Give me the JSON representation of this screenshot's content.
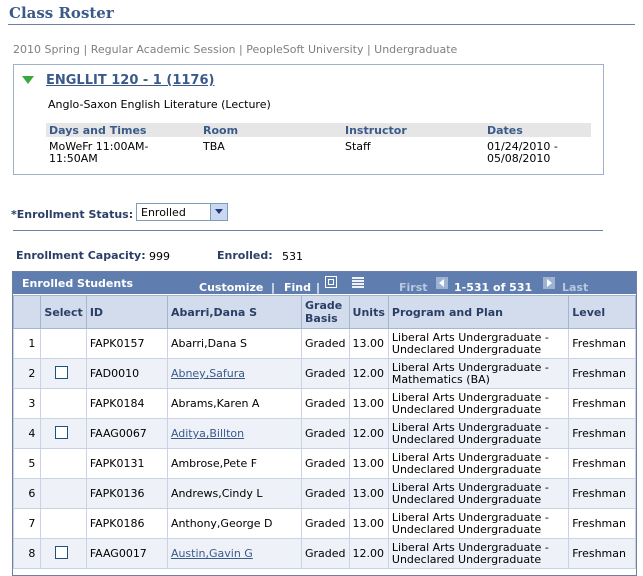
{
  "page": {
    "title": "Class Roster",
    "breadcrumb": "2010 Spring | Regular Academic Session | PeopleSoft University | Undergraduate"
  },
  "class_info": {
    "link": "ENGLLIT 120 - 1 (1176)",
    "description": "Anglo-Saxon English Literature (Lecture)",
    "headers": [
      "Days and Times",
      "Room",
      "Instructor",
      "Dates"
    ],
    "days_times": "MoWeFr 11:00AM-\n11:50AM",
    "room": "TBA",
    "instructor": "Staff",
    "dates": "01/24/2010 -\n05/08/2010"
  },
  "enrollment": {
    "status_label": "*Enrollment Status:",
    "status_value": "Enrolled",
    "capacity_label": "Enrollment Capacity:",
    "capacity_value": "999",
    "enrolled_label": "Enrolled:",
    "enrolled_value": "531"
  },
  "grid": {
    "title": "Enrolled Students",
    "customize": "Customize",
    "find": "Find",
    "sep": "|",
    "first": "First",
    "range": "1-531 of 531",
    "last": "Last",
    "columns": [
      "",
      "Select",
      "ID",
      "Abarri,Dana S",
      "Grade Basis",
      "Units",
      "Program and Plan",
      "Level"
    ],
    "rows": [
      {
        "n": "1",
        "select": false,
        "id": "FAPK0157",
        "name": "Abarri,Dana S",
        "link": false,
        "grade": "Graded",
        "units": "13.00",
        "plan": "Liberal Arts Undergraduate - Undeclared Undergraduate",
        "level": "Freshman"
      },
      {
        "n": "2",
        "select": true,
        "id": "FAD0010",
        "name": "Abney,Safura",
        "link": true,
        "grade": "Graded",
        "units": "12.00",
        "plan": "Liberal Arts Undergraduate - Mathematics (BA)",
        "level": "Freshman"
      },
      {
        "n": "3",
        "select": false,
        "id": "FAPK0184",
        "name": "Abrams,Karen A",
        "link": false,
        "grade": "Graded",
        "units": "13.00",
        "plan": "Liberal Arts Undergraduate - Undeclared Undergraduate",
        "level": "Freshman"
      },
      {
        "n": "4",
        "select": true,
        "id": "FAAG0067",
        "name": "Aditya,Billton",
        "link": true,
        "grade": "Graded",
        "units": "12.00",
        "plan": "Liberal Arts Undergraduate - Undeclared Undergraduate",
        "level": "Freshman"
      },
      {
        "n": "5",
        "select": false,
        "id": "FAPK0131",
        "name": "Ambrose,Pete F",
        "link": false,
        "grade": "Graded",
        "units": "13.00",
        "plan": "Liberal Arts Undergraduate - Undeclared Undergraduate",
        "level": "Freshman"
      },
      {
        "n": "6",
        "select": false,
        "id": "FAPK0136",
        "name": "Andrews,Cindy L",
        "link": false,
        "grade": "Graded",
        "units": "13.00",
        "plan": "Liberal Arts Undergraduate - Undeclared Undergraduate",
        "level": "Freshman"
      },
      {
        "n": "7",
        "select": false,
        "id": "FAPK0186",
        "name": "Anthony,George D",
        "link": false,
        "grade": "Graded",
        "units": "13.00",
        "plan": "Liberal Arts Undergraduate - Undeclared Undergraduate",
        "level": "Freshman"
      },
      {
        "n": "8",
        "select": true,
        "id": "FAAG0017",
        "name": "Austin,Gavin G",
        "link": true,
        "grade": "Graded",
        "units": "12.00",
        "plan": "Liberal Arts Undergraduate - Undeclared Undergraduate",
        "level": "Freshman"
      }
    ]
  },
  "colors": {
    "accent": "#3a5a8a",
    "grid_header": "#5f7eaf"
  }
}
